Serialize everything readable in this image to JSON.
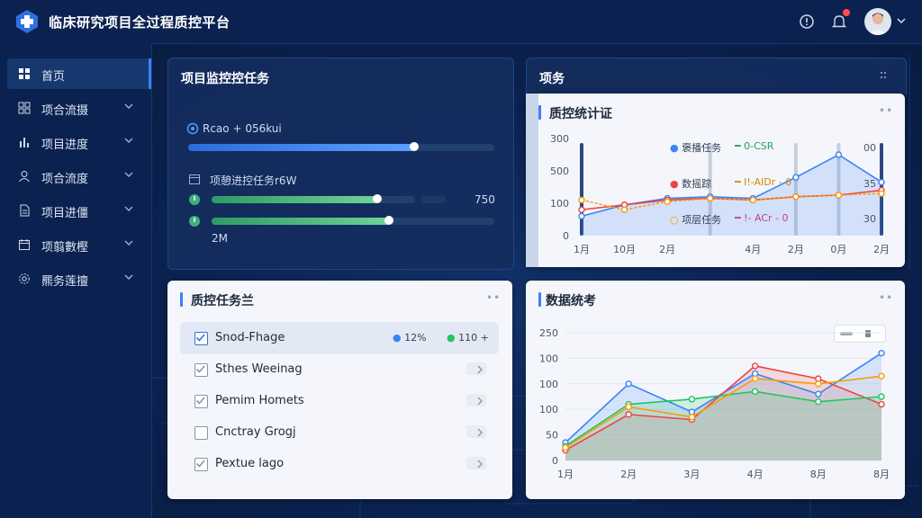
{
  "header": {
    "title": "临床研究项目全过程质控平台",
    "logo_icon": "cross-hexagon-icon",
    "icons": [
      "info-icon",
      "bell-icon",
      "user-avatar",
      "chevron-down-icon"
    ]
  },
  "sidebar": {
    "items": [
      {
        "label": "首页",
        "icon": "dashboard-icon",
        "active": true
      },
      {
        "label": "项合流摄",
        "icon": "grid-icon"
      },
      {
        "label": "项目进度",
        "icon": "chart-bars-icon"
      },
      {
        "label": "项合流度",
        "icon": "user-icon"
      },
      {
        "label": "项目进僵",
        "icon": "document-icon"
      },
      {
        "label": "项翦數樫",
        "icon": "calendar-icon"
      },
      {
        "label": "羆务莲擅",
        "icon": "gear-icon"
      }
    ]
  },
  "monitor": {
    "title": "项目监控控任务",
    "row1_label": "Rcao + 056kui",
    "row1_progress": 0.74,
    "row2_label": "项憩进控任务r6W",
    "row3_progress": 0.82,
    "row3_value": "750",
    "row4_progress": 0.63,
    "footer": "2M"
  },
  "tasks_panel": {
    "title": "项务"
  },
  "stats": {
    "title": "质控统计证",
    "legend": [
      {
        "label": "褒播任务",
        "color": "#3b82f6"
      },
      {
        "label": "0-CSR",
        "color": "#22c55e"
      },
      {
        "label": "数摇踪",
        "color": "#ef4444"
      },
      {
        "label": "I!-AIDr - 0",
        "color": "#f59e0b"
      },
      {
        "label": "项层任务",
        "color": "#f59e0b"
      },
      {
        "label": "!- ACr - 0",
        "color": "#ec4899"
      }
    ],
    "right_labels": [
      "00",
      "35",
      "30"
    ]
  },
  "task_list": {
    "title": "质控任务兰",
    "rows": [
      {
        "label": "Snod-Fhage",
        "checked": true,
        "stat1": "12%",
        "stat2": "110 +",
        "selected": true
      },
      {
        "label": "Sthes Weeinag",
        "checked": true
      },
      {
        "label": "Pemim Homets",
        "checked": true
      },
      {
        "label": "Cnctray Grogj",
        "checked": false
      },
      {
        "label": "Pextue lago",
        "checked": true
      }
    ]
  },
  "chart_data": [
    {
      "type": "line",
      "title": "质控统计证",
      "categories": [
        "1月",
        "10月",
        "2月",
        "",
        "4月",
        "2月",
        "0月",
        "2月"
      ],
      "y_ticks": [
        "0",
        "100",
        "500",
        "300"
      ],
      "series": [
        {
          "name": "褒播任务",
          "color": "#3b82f6",
          "values": [
            60,
            95,
            115,
            120,
            115,
            180,
            250,
            165
          ]
        },
        {
          "name": "数摇踪",
          "color": "#ef4444",
          "values": [
            80,
            95,
            110,
            115,
            110,
            120,
            125,
            140
          ]
        },
        {
          "name": "项层任务",
          "color": "#f59e0b",
          "values": [
            110,
            80,
            105,
            115,
            110,
            120,
            125,
            130
          ]
        }
      ]
    },
    {
      "type": "area",
      "title": "数据统考",
      "categories": [
        "1月",
        "2月",
        "3月",
        "4月",
        "8月",
        "8月"
      ],
      "y_ticks": [
        "0",
        "50",
        "100",
        "100",
        "100",
        "250"
      ],
      "series": [
        {
          "color": "#3b82f6",
          "values": [
            35,
            150,
            95,
            170,
            130,
            210
          ]
        },
        {
          "color": "#ef4444",
          "values": [
            20,
            90,
            80,
            185,
            160,
            110
          ]
        },
        {
          "color": "#22c55e",
          "values": [
            28,
            110,
            120,
            135,
            115,
            125
          ]
        },
        {
          "color": "#f59e0b",
          "values": [
            25,
            105,
            85,
            160,
            150,
            165
          ]
        }
      ]
    }
  ]
}
